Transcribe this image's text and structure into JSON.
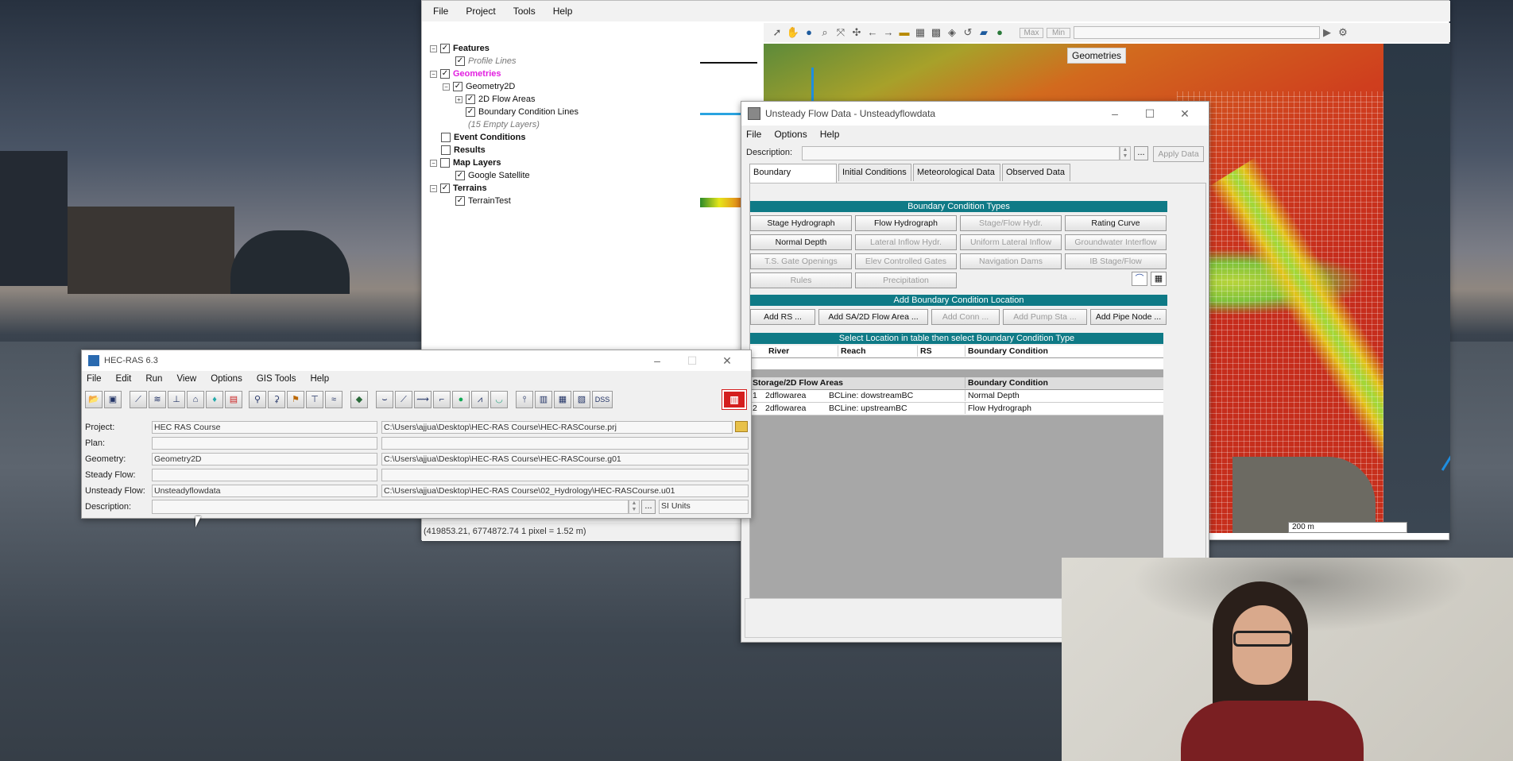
{
  "ras_mapper": {
    "menus": [
      "File",
      "Project",
      "Tools",
      "Help"
    ],
    "toolbar": {
      "max_label": "Max",
      "min_label": "Min"
    },
    "layers": {
      "features": "Features",
      "profile_lines": "Profile Lines",
      "geometries": "Geometries",
      "geometry2d": "Geometry2D",
      "flow_areas": "2D Flow Areas",
      "bc_lines": "Boundary Condition Lines",
      "empty_layers": "(15 Empty Layers)",
      "event_conditions": "Event Conditions",
      "results": "Results",
      "map_layers": "Map Layers",
      "google_satellite": "Google Satellite",
      "terrains": "Terrains",
      "terrain_test": "TerrainTest"
    },
    "map_tooltip": "Geometries",
    "scale_label": "200 m",
    "status": "(419853.21, 6774872.74  1 pixel = 1.52 m)",
    "colors": {
      "geometries_label": "#e21fe0"
    }
  },
  "unsteady": {
    "title": "Unsteady Flow Data - Unsteadyflowdata",
    "menus": [
      "File",
      "Options",
      "Help"
    ],
    "description_label": "Description:",
    "apply_button": "Apply Data",
    "tabs": [
      "Boundary Conditions",
      "Initial Conditions",
      "Meteorological Data",
      "Observed Data"
    ],
    "bc_types_header": "Boundary Condition Types",
    "bc_types": [
      {
        "label": "Stage Hydrograph",
        "enabled": true
      },
      {
        "label": "Flow Hydrograph",
        "enabled": true
      },
      {
        "label": "Stage/Flow Hydr.",
        "enabled": false
      },
      {
        "label": "Rating Curve",
        "enabled": true
      },
      {
        "label": "Normal Depth",
        "enabled": true
      },
      {
        "label": "Lateral Inflow Hydr.",
        "enabled": false
      },
      {
        "label": "Uniform Lateral Inflow",
        "enabled": false
      },
      {
        "label": "Groundwater Interflow",
        "enabled": false
      },
      {
        "label": "T.S. Gate Openings",
        "enabled": false
      },
      {
        "label": "Elev Controlled Gates",
        "enabled": false
      },
      {
        "label": "Navigation Dams",
        "enabled": false
      },
      {
        "label": "IB Stage/Flow",
        "enabled": false
      },
      {
        "label": "Rules",
        "enabled": false
      },
      {
        "label": "Precipitation",
        "enabled": false
      }
    ],
    "add_location_header": "Add Boundary Condition Location",
    "add_buttons": [
      {
        "label": "Add RS ...",
        "enabled": true
      },
      {
        "label": "Add SA/2D Flow Area ...",
        "enabled": true
      },
      {
        "label": "Add Conn ...",
        "enabled": false
      },
      {
        "label": "Add Pump Sta ...",
        "enabled": false
      },
      {
        "label": "Add Pipe Node ...",
        "enabled": true
      }
    ],
    "select_header": "Select Location in table then select Boundary Condition Type",
    "table1_headers": [
      "River",
      "Reach",
      "RS",
      "Boundary Condition"
    ],
    "table2_headers": [
      "Storage/2D Flow Areas",
      "Boundary Condition"
    ],
    "rows": [
      {
        "num": "1",
        "area": "2dflowarea",
        "bcline": "BCLine: dowstreamBC",
        "bc": "Normal Depth"
      },
      {
        "num": "2",
        "area": "2dflowarea",
        "bcline": "BCLine: upstreamBC",
        "bc": "Flow Hydrograph"
      }
    ]
  },
  "hecras": {
    "title": "HEC-RAS 6.3",
    "menus": [
      "File",
      "Edit",
      "Run",
      "View",
      "Options",
      "GIS Tools",
      "Help"
    ],
    "dss_label": "DSS",
    "labels": {
      "project": "Project:",
      "plan": "Plan:",
      "geometry": "Geometry:",
      "steady": "Steady Flow:",
      "unsteady": "Unsteady Flow:",
      "description": "Description:"
    },
    "project_name": "HEC RAS Course",
    "project_path": "C:\\Users\\ajjua\\Desktop\\HEC-RAS Course\\HEC-RASCourse.prj",
    "geometry_name": "Geometry2D",
    "geometry_path": "C:\\Users\\ajjua\\Desktop\\HEC-RAS Course\\HEC-RASCourse.g01",
    "unsteady_name": "Unsteadyflowdata",
    "unsteady_path": "C:\\Users\\ajjua\\Desktop\\HEC-RAS Course\\02_Hydrology\\HEC-RASCourse.u01",
    "units": "SI Units"
  }
}
